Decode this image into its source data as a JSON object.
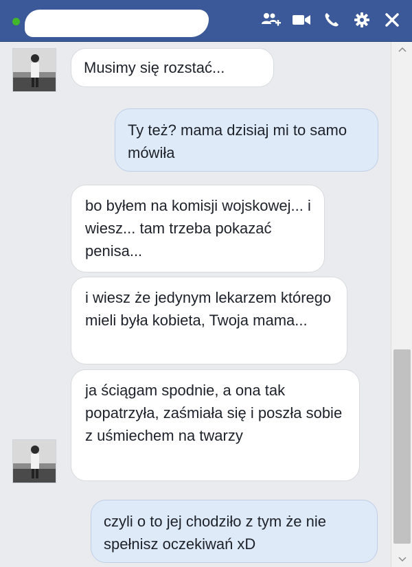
{
  "header": {
    "icons": [
      "add-people-icon",
      "video-call-icon",
      "phone-icon",
      "settings-icon",
      "close-icon"
    ]
  },
  "messages": [
    {
      "direction": "incoming",
      "text": "Musimy się rozstać..."
    },
    {
      "direction": "outgoing",
      "text": "Ty też? mama dzisiaj mi to samo mówiła"
    },
    {
      "direction": "incoming",
      "text": "bo byłem na komisji wojskowej... i wiesz... tam trzeba pokazać penisa..."
    },
    {
      "direction": "incoming",
      "text": "i wiesz że jedynym lekarzem którego mieli była kobieta, Twoja mama..."
    },
    {
      "direction": "incoming",
      "text": "ja ściągam spodnie, a ona tak popatrzyła, zaśmiała się i poszła sobie z uśmiechem na twarzy"
    },
    {
      "direction": "outgoing",
      "text": "czyli o to jej chodziło z tym że nie spełnisz oczekiwań xD"
    }
  ],
  "colors": {
    "header": "#3b5998",
    "background": "#e9ebee",
    "incoming_bubble": "#ffffff",
    "outgoing_bubble": "#dfeaf9",
    "online": "#42b72a"
  }
}
